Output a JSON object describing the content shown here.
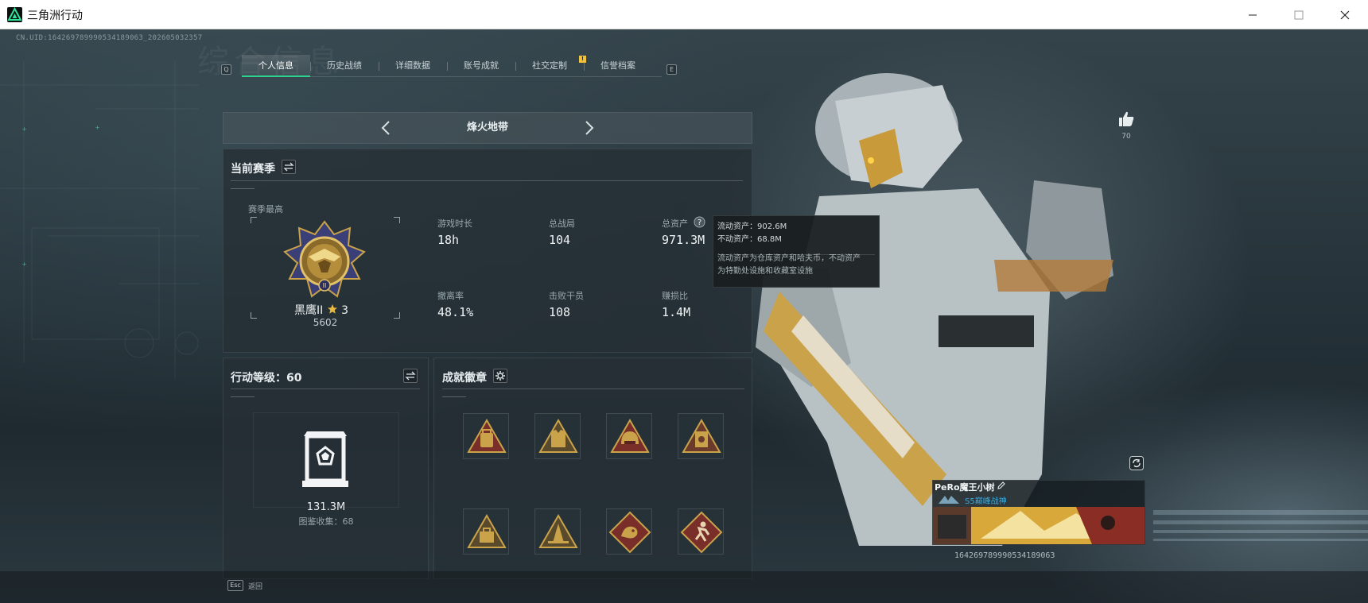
{
  "window": {
    "title": "三角洲行动",
    "minimize_glyph": "—",
    "maximize_glyph": "☐",
    "close_glyph": "✕"
  },
  "uid_text": "CN.UID:164269789990534189063_202605032357",
  "bg_title": "综合信息",
  "tabs": [
    {
      "label": "个人信息",
      "active": true
    },
    {
      "label": "历史战绩",
      "active": false
    },
    {
      "label": "详细数据",
      "active": false
    },
    {
      "label": "账号成就",
      "active": false
    },
    {
      "label": "社交定制",
      "active": false
    },
    {
      "label": "信誉档案",
      "active": false
    }
  ],
  "tab_keys": {
    "left": "Q",
    "right": "E"
  },
  "tab_badge": "!",
  "mode": {
    "title": "烽火地带"
  },
  "season": {
    "title": "当前赛季",
    "best_label": "赛季最高",
    "rank_name": "黑鹰II",
    "rank_stars": "3",
    "rank_points": "5602",
    "stats": {
      "play_time": {
        "label": "游戏时长",
        "value": "18h"
      },
      "matches": {
        "label": "总战局",
        "value": "104"
      },
      "assets": {
        "label": "总资产",
        "value": "971.3M"
      },
      "extract_rate": {
        "label": "撤离率",
        "value": "48.1%"
      },
      "kills": {
        "label": "击败干员",
        "value": "108"
      },
      "profit_ratio": {
        "label": "赚损比",
        "value": "1.4M"
      }
    }
  },
  "tooltip": {
    "liquid": "流动资产：902.6M",
    "fixed": "不动资产：68.8M",
    "desc_line1": "流动资产为仓库资产和哈夫币，不动资产",
    "desc_line2": "为特勤处设施和收藏室设施"
  },
  "level": {
    "title": "行动等级：60",
    "value": "131.3M",
    "collection": "图鉴收集：68"
  },
  "badges": {
    "title": "成就徽章"
  },
  "likes": {
    "count": "70"
  },
  "player": {
    "name": "PeRo魔王小树",
    "subtitle": "S5巅峰战神",
    "id": "164269789990534189063"
  },
  "footer": {
    "esc_key": "Esc",
    "esc_label": "返回"
  },
  "colors": {
    "accent": "#2fd28c",
    "gold": "#c9a24a",
    "badge_red": "#7a2e2a"
  }
}
